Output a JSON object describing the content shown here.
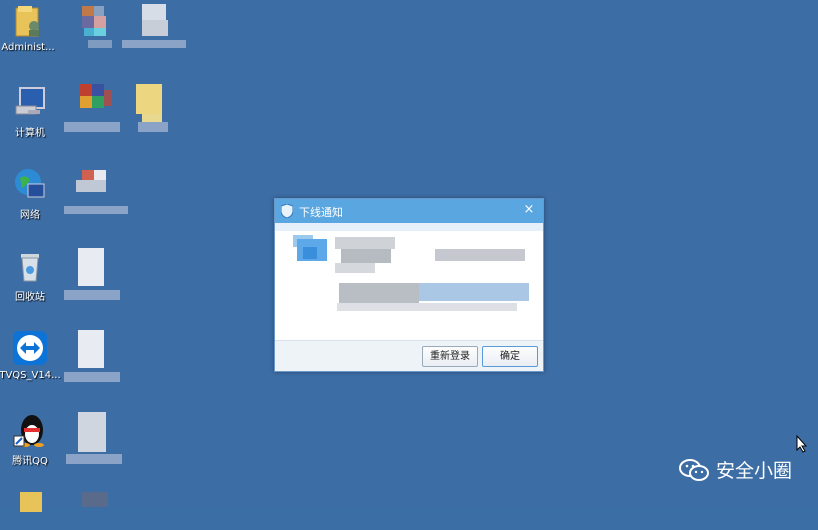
{
  "desktop": {
    "icons": [
      {
        "label": "Administ..."
      },
      {
        "label": "计算机"
      },
      {
        "label": "网络"
      },
      {
        "label": "回收站"
      },
      {
        "label": "TVQS_V14..."
      },
      {
        "label": "腾讯QQ"
      }
    ]
  },
  "dialog": {
    "title": "下线通知",
    "close_glyph": "×",
    "relogin_label": "重新登录",
    "ok_label": "确定"
  },
  "watermark": {
    "text": "安全小圈"
  },
  "colors": {
    "desktop": "#3c6da5",
    "titlebar": "#5aa6e0"
  }
}
